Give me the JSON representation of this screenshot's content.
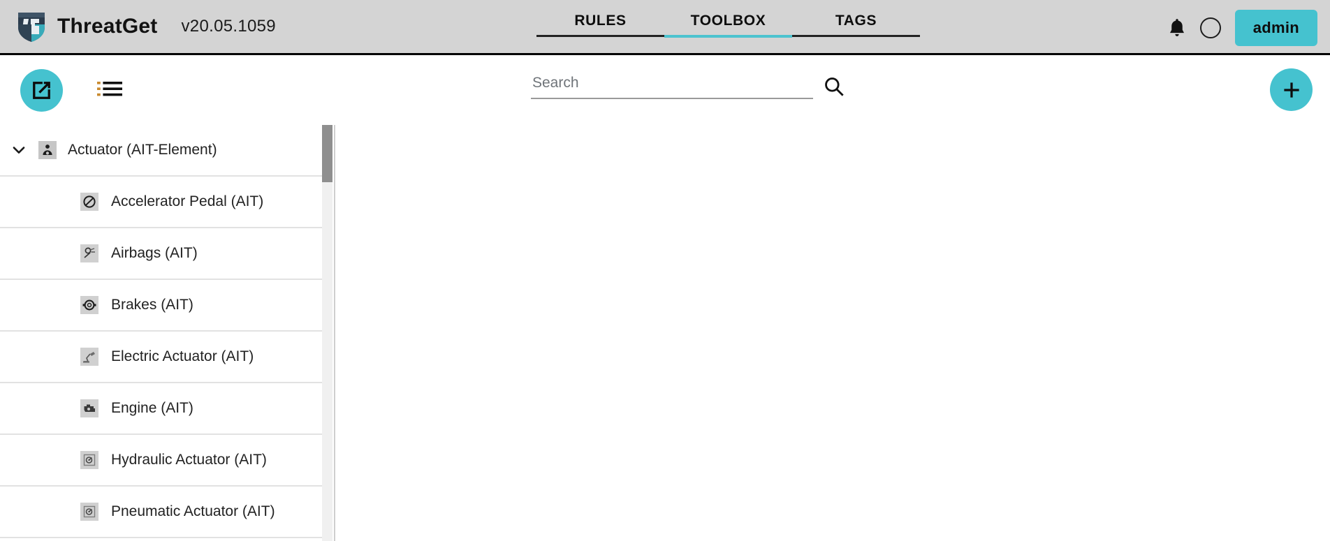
{
  "header": {
    "logo_icon": "threatget-shield-logo",
    "brand_name": "ThreatGet",
    "version": "v20.05.1059",
    "tabs": [
      {
        "label": "RULES",
        "active": false
      },
      {
        "label": "TOOLBOX",
        "active": true
      },
      {
        "label": "TAGS",
        "active": false
      }
    ],
    "bell_icon": "notification-bell-icon",
    "avatar_icon": "user-avatar-circle-icon",
    "admin_label": "admin",
    "accent_color": "#45c2cf",
    "background_color": "#d4d4d4"
  },
  "toolbar": {
    "export_icon": "external-link-export-icon",
    "list_icon": "list-view-icon",
    "search": {
      "value": "",
      "placeholder": "Search",
      "icon": "search-magnifier-icon"
    },
    "add_icon": "plus-add-icon"
  },
  "sidebar": {
    "root": {
      "chevron_icon": "chevron-down-icon",
      "node_icon": "actuator-element-icon",
      "label": "Actuator  (AIT-Element)",
      "expanded": true
    },
    "children": [
      {
        "icon": "accelerator-pedal-icon",
        "label": "Accelerator Pedal (AIT)"
      },
      {
        "icon": "airbags-icon",
        "label": "Airbags (AIT)"
      },
      {
        "icon": "brakes-icon",
        "label": "Brakes (AIT)"
      },
      {
        "icon": "electric-actuator-icon",
        "label": "Electric Actuator (AIT)"
      },
      {
        "icon": "engine-icon",
        "label": "Engine (AIT)"
      },
      {
        "icon": "hydraulic-actuator-icon",
        "label": "Hydraulic Actuator (AIT)"
      },
      {
        "icon": "pneumatic-actuator-icon",
        "label": "Pneumatic Actuator (AIT)"
      }
    ],
    "scrollbar": {
      "thumb_position": "top"
    }
  }
}
